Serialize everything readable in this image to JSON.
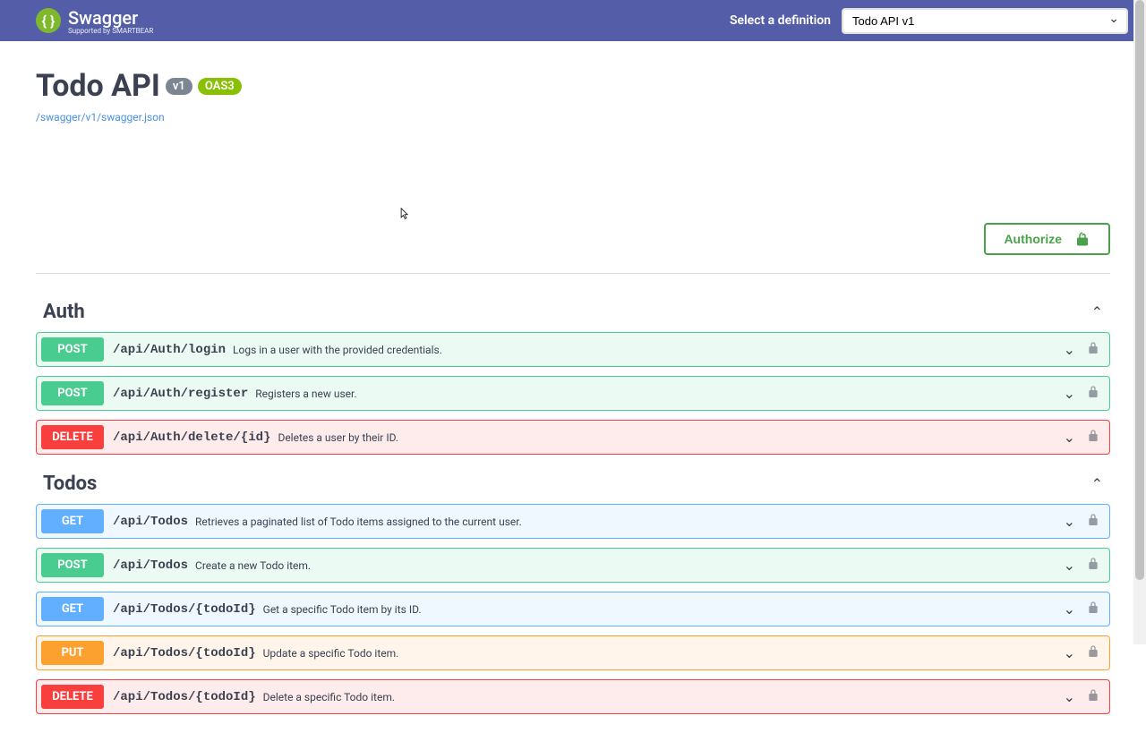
{
  "header": {
    "logo_text": "Swagger",
    "logo_sub": "Supported by SMARTBEAR",
    "definition_label": "Select a definition",
    "definition_value": "Todo API v1"
  },
  "info": {
    "title": "Todo API",
    "version_badge": "v1",
    "oas_badge": "OAS3",
    "spec_url": "/swagger/v1/swagger.json"
  },
  "authorize_label": "Authorize",
  "tags": [
    {
      "name": "Auth",
      "ops": [
        {
          "method": "POST",
          "mclass": "m-post",
          "bclass": "op-post",
          "path": "/api/Auth/login",
          "summary": "Logs in a user with the provided credentials."
        },
        {
          "method": "POST",
          "mclass": "m-post",
          "bclass": "op-post",
          "path": "/api/Auth/register",
          "summary": "Registers a new user."
        },
        {
          "method": "DELETE",
          "mclass": "m-delete",
          "bclass": "op-delete",
          "path": "/api/Auth/delete/{id}",
          "summary": "Deletes a user by their ID."
        }
      ]
    },
    {
      "name": "Todos",
      "ops": [
        {
          "method": "GET",
          "mclass": "m-get",
          "bclass": "op-get",
          "path": "/api/Todos",
          "summary": "Retrieves a paginated list of Todo items assigned to the current user."
        },
        {
          "method": "POST",
          "mclass": "m-post",
          "bclass": "op-post",
          "path": "/api/Todos",
          "summary": "Create a new Todo item."
        },
        {
          "method": "GET",
          "mclass": "m-get",
          "bclass": "op-get",
          "path": "/api/Todos/{todoId}",
          "summary": "Get a specific Todo item by its ID."
        },
        {
          "method": "PUT",
          "mclass": "m-put",
          "bclass": "op-put",
          "path": "/api/Todos/{todoId}",
          "summary": "Update a specific Todo item."
        },
        {
          "method": "DELETE",
          "mclass": "m-delete",
          "bclass": "op-delete",
          "path": "/api/Todos/{todoId}",
          "summary": "Delete a specific Todo item."
        }
      ]
    }
  ]
}
